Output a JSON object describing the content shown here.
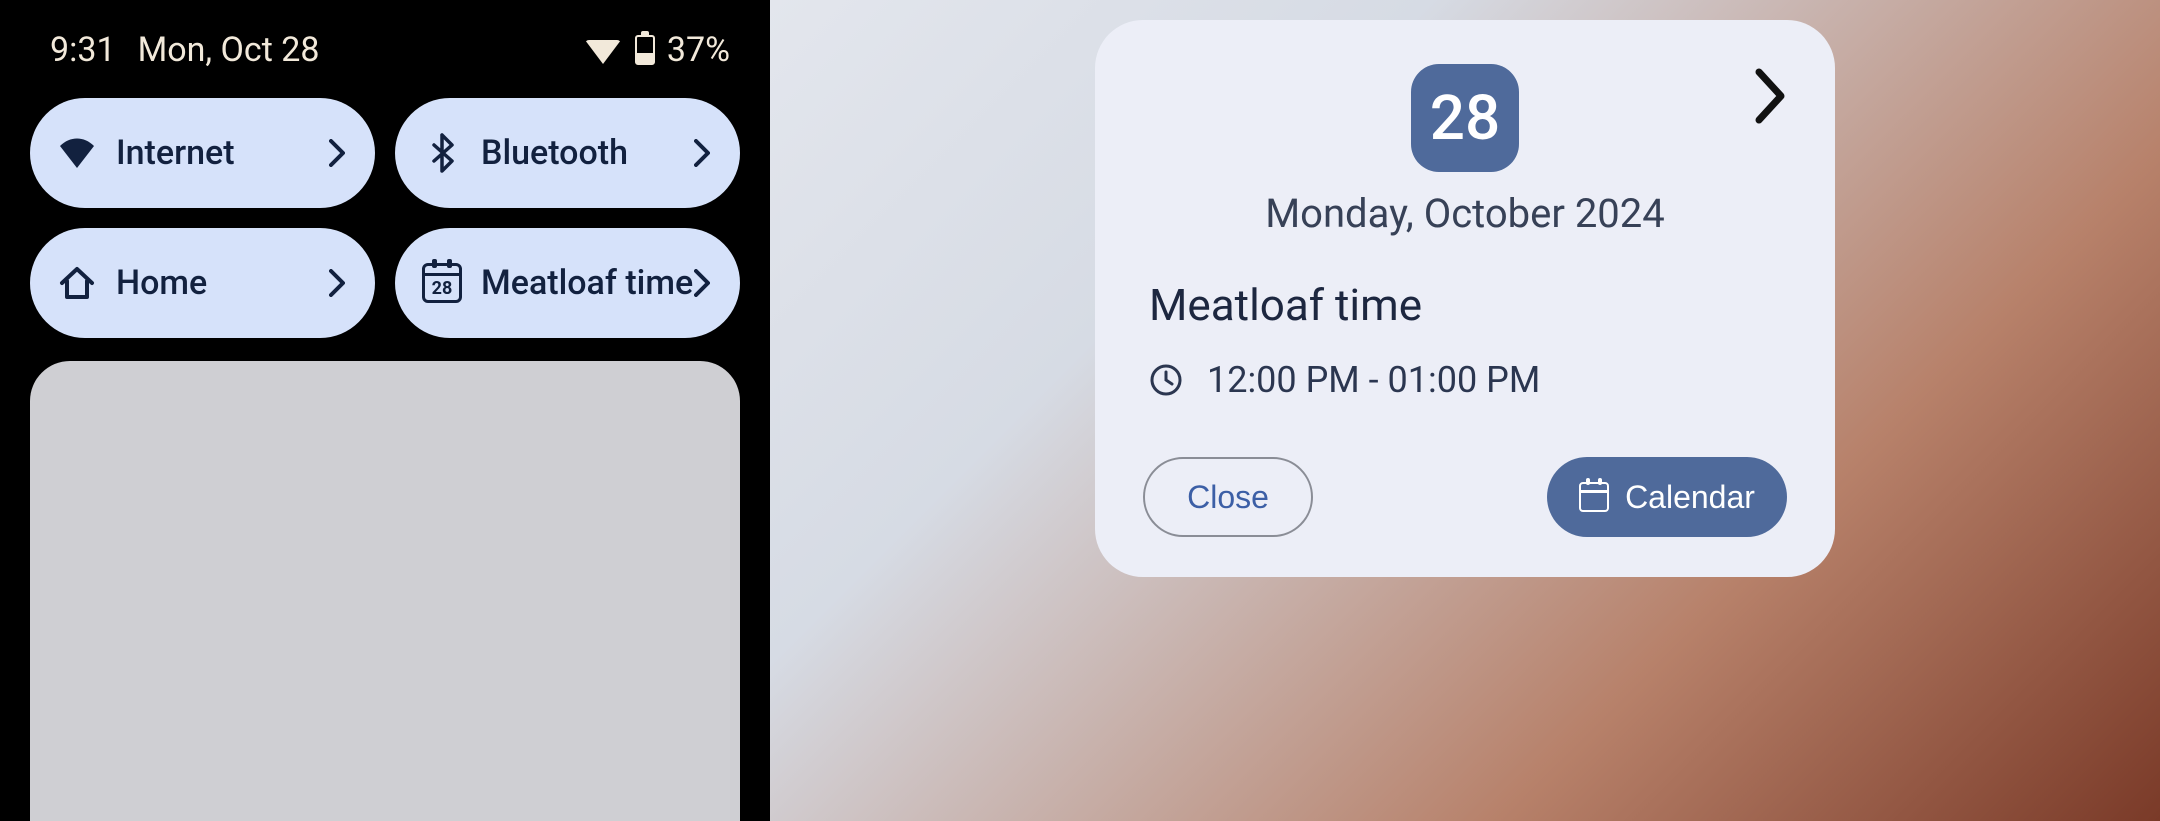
{
  "status": {
    "time": "9:31",
    "date": "Mon, Oct 28",
    "battery_pct": "37%"
  },
  "quick_settings": {
    "tiles": [
      {
        "label": "Internet",
        "icon": "wifi"
      },
      {
        "label": "Bluetooth",
        "icon": "bluetooth"
      },
      {
        "label": "Home",
        "icon": "home"
      },
      {
        "label": "Meatloaf time",
        "icon": "calendar-28"
      }
    ]
  },
  "calendar_card": {
    "day_number": "28",
    "date_full": "Monday, October 2024",
    "event_title": "Meatloaf time",
    "event_time": "12:00 PM - 01:00 PM",
    "close_label": "Close",
    "calendar_label": "Calendar"
  }
}
